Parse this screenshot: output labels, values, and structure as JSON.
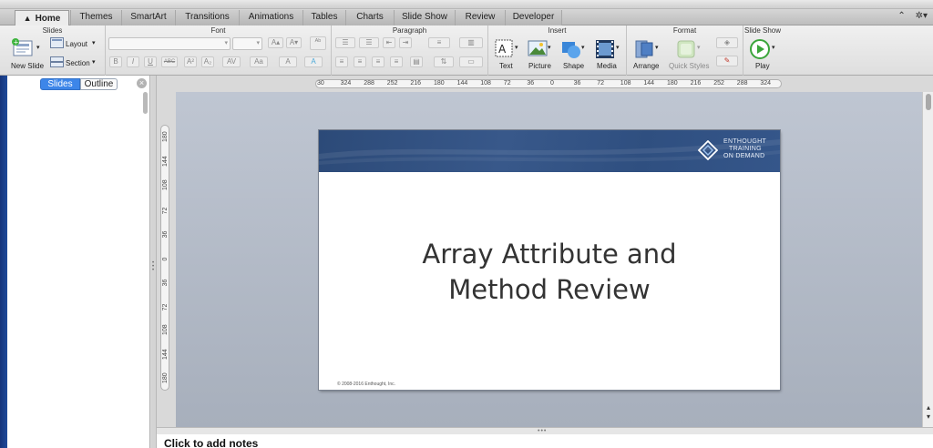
{
  "tabs": [
    {
      "label": "Home",
      "active": true
    },
    {
      "label": "Themes"
    },
    {
      "label": "SmartArt"
    },
    {
      "label": "Transitions"
    },
    {
      "label": "Animations"
    },
    {
      "label": "Tables"
    },
    {
      "label": "Charts"
    },
    {
      "label": "Slide Show"
    },
    {
      "label": "Review"
    },
    {
      "label": "Developer"
    }
  ],
  "ribbon": {
    "groups": {
      "slides": "Slides",
      "font": "Font",
      "paragraph": "Paragraph",
      "insert": "Insert",
      "format": "Format",
      "slideshow": "Slide Show"
    },
    "new_slide": "New Slide",
    "layout": "Layout",
    "section": "Section",
    "font_buttons": [
      "B",
      "I",
      "U",
      "ABC",
      "A²",
      "A₂",
      "AV",
      "Aa",
      "A",
      "A"
    ],
    "text": "Text",
    "picture": "Picture",
    "shape": "Shape",
    "media": "Media",
    "arrange": "Arrange",
    "quick_styles": "Quick Styles",
    "play": "Play"
  },
  "left_panel": {
    "slides_tab": "Slides",
    "outline_tab": "Outline"
  },
  "ruler": {
    "horizontal": [
      "30",
      "324",
      "288",
      "252",
      "216",
      "180",
      "144",
      "108",
      "72",
      "36",
      "0",
      "36",
      "72",
      "108",
      "144",
      "180",
      "216",
      "252",
      "288",
      "324"
    ],
    "vertical": [
      "180",
      "144",
      "108",
      "72",
      "36",
      "0",
      "36",
      "72",
      "108",
      "144",
      "180"
    ]
  },
  "slide": {
    "logo_line1": "ENTHOUGHT",
    "logo_line2": "TRAINING",
    "logo_line3": "ON DEMAND",
    "title_line1": "Array Attribute and",
    "title_line2": "Method Review",
    "copyright": "© 2008-2016 Enthought, Inc."
  },
  "notes": {
    "placeholder": "Click to add notes"
  },
  "colors": {
    "accent_blue": "#3d86e9",
    "banner_blue": "#2f4f80",
    "play_green": "#3aa53a"
  }
}
